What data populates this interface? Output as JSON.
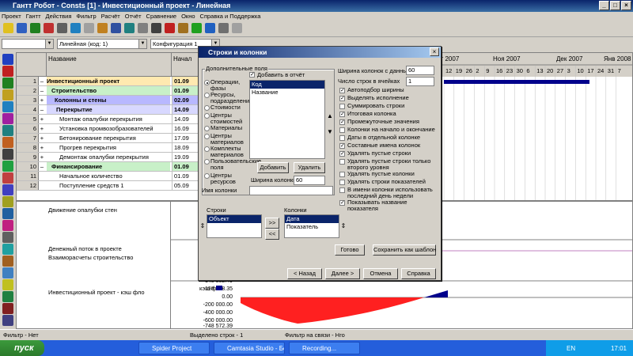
{
  "window": {
    "title": "Гантт Робот - Consts [1] - Инвестиционный проект - Линейная"
  },
  "menu": [
    "Проект",
    "Гантт",
    "Действия",
    "Фильтр",
    "Расчёт",
    "Отчёт",
    "Сравнение",
    "Окно",
    "Справка и Поддержка"
  ],
  "toolbar2": {
    "code_combo": "Линейная (код: 1)",
    "config_combo": "Конфигурация 1"
  },
  "grid": {
    "col_name": "Название",
    "col_start": "Начал",
    "rows": [
      {
        "num": "1",
        "pm": "–",
        "name": "Инвестиционный проект",
        "start": "01.09",
        "style": "l1"
      },
      {
        "num": "2",
        "pm": "–",
        "name": "Строительство",
        "start": "01.09",
        "style": "l2"
      },
      {
        "num": "3",
        "pm": "+",
        "name": "Колонны и стены",
        "start": "02.09",
        "style": "l3"
      },
      {
        "num": "4",
        "pm": "–",
        "name": "Перекрытие",
        "start": "14.09",
        "style": "l4"
      },
      {
        "num": "5",
        "pm": "+",
        "name": "Монтаж опалубки перекрытия",
        "start": "14.09",
        "style": "n"
      },
      {
        "num": "6",
        "pm": "+",
        "name": "Установка промвозобразователей",
        "start": "16.09",
        "style": "n"
      },
      {
        "num": "7",
        "pm": "+",
        "name": "Бетонирование перекрытия",
        "start": "17.09",
        "style": "n"
      },
      {
        "num": "8",
        "pm": "+",
        "name": "Прогрев перекрытия",
        "start": "18.09",
        "style": "n"
      },
      {
        "num": "9",
        "pm": "+",
        "name": "Демонтаж опалубки перекрытия",
        "start": "19.09",
        "style": "n"
      },
      {
        "num": "10",
        "pm": "–",
        "name": "Финансирование",
        "start": "01.09",
        "style": "l2"
      },
      {
        "num": "11",
        "pm": "",
        "name": "Начальное количество",
        "start": "01.09",
        "style": "n"
      },
      {
        "num": "12",
        "pm": "",
        "name": "Поступление средств 1",
        "start": "05.09",
        "style": "n"
      }
    ]
  },
  "timeline": {
    "months": [
      "кт 2007",
      "Ноя 2007",
      "Дек 2007",
      "Янв 2008"
    ],
    "days": [
      "12",
      "19",
      "26",
      "2",
      "9",
      "16",
      "23",
      "30",
      "6",
      "13",
      "20",
      "27",
      "3",
      "10",
      "17",
      "24",
      "31",
      "7"
    ]
  },
  "lower": {
    "labels": [
      "Движение опалубки стен",
      "Денежный поток в проекте",
      "Взаиморасчеты строительство",
      "Инвестиционный проект - кэш фло"
    ],
    "chart_title": "кэш фло",
    "axis_ticks": [
      "145 802.49",
      "198 018.35",
      "0.00",
      "-200 000.00",
      "-400 000.00",
      "-600 000.00",
      "-748 572.39"
    ]
  },
  "dialog": {
    "title": "Строки и колонки",
    "group_extra": "Дополнительные поля",
    "add_to_report": "Добавить в отчёт",
    "radios": [
      "Операции, фазы",
      "Ресурсы, подразделения",
      "Стоимости",
      "Центры стоимостей",
      "Материалы",
      "Центры материалов",
      "Комплекты материалов",
      "Пользовательские поля",
      "Центры ресурсов"
    ],
    "fields_list": [
      "Код",
      "Название"
    ],
    "btn_add": "Добавить",
    "btn_delete": "Удалить",
    "col_width_label": "Ширина колонки",
    "col_width_value": "60",
    "col_name_label": "Имя колонки",
    "col_name_value": "",
    "data_col_width_label": "Ширина колонок с данными",
    "data_col_width_value": "60",
    "rows_in_cell_label": "Число строк в ячейках",
    "rows_in_cell_value": "1",
    "checks": [
      {
        "label": "Автоподбор ширины",
        "on": true
      },
      {
        "label": "Выделять исполнение",
        "on": true
      },
      {
        "label": "Суммировать строки",
        "on": false
      },
      {
        "label": "Итоговая колонка",
        "on": true
      },
      {
        "label": "Промежуточные значения",
        "on": true
      },
      {
        "label": "Колонки на начало и окончание",
        "on": false
      },
      {
        "label": "Даты в отдельной колонке",
        "on": false
      },
      {
        "label": "Составные имена колонок",
        "on": true
      },
      {
        "label": "Удалять пустые строки",
        "on": true
      },
      {
        "label": "Удалять пустые строки только второго уровня",
        "on": false
      },
      {
        "label": "Удалять пустые колонки",
        "on": false
      },
      {
        "label": "Удалять строки показателей",
        "on": false
      },
      {
        "label": "В имени колонки использовать последний день недели",
        "on": false
      },
      {
        "label": "Показывать название показателя",
        "on": true
      }
    ],
    "rows_label": "Строки",
    "rows_list": [
      "Объект"
    ],
    "cols_label": "Колонки",
    "cols_list": [
      "Дата",
      "Показатель"
    ],
    "btn_right": ">>",
    "btn_left": "<<",
    "btn_ready": "Готово",
    "btn_save_template": "Сохранить как шаблон",
    "btn_back": "< Назад",
    "btn_next": "Далее >",
    "btn_cancel": "Отмена",
    "btn_help": "Справка"
  },
  "status": {
    "filter": "Фильтр - Нет",
    "selected": "Выделено строк - 1",
    "link_filter": "Фильтр на связи - Нго"
  },
  "taskbar": {
    "start": "пуск",
    "tasks": [
      "Spider Project",
      "Camtasia Studio - Без...",
      "Recording..."
    ],
    "lang": "EN",
    "clock": "17:01"
  },
  "colors": {
    "l1": "#ffe9b0",
    "l2": "#c8f0c8",
    "l3": "#b8b8ff",
    "l4": "#d8d8ff",
    "bar": "#00008b",
    "cash_neg": "#ff2020"
  }
}
